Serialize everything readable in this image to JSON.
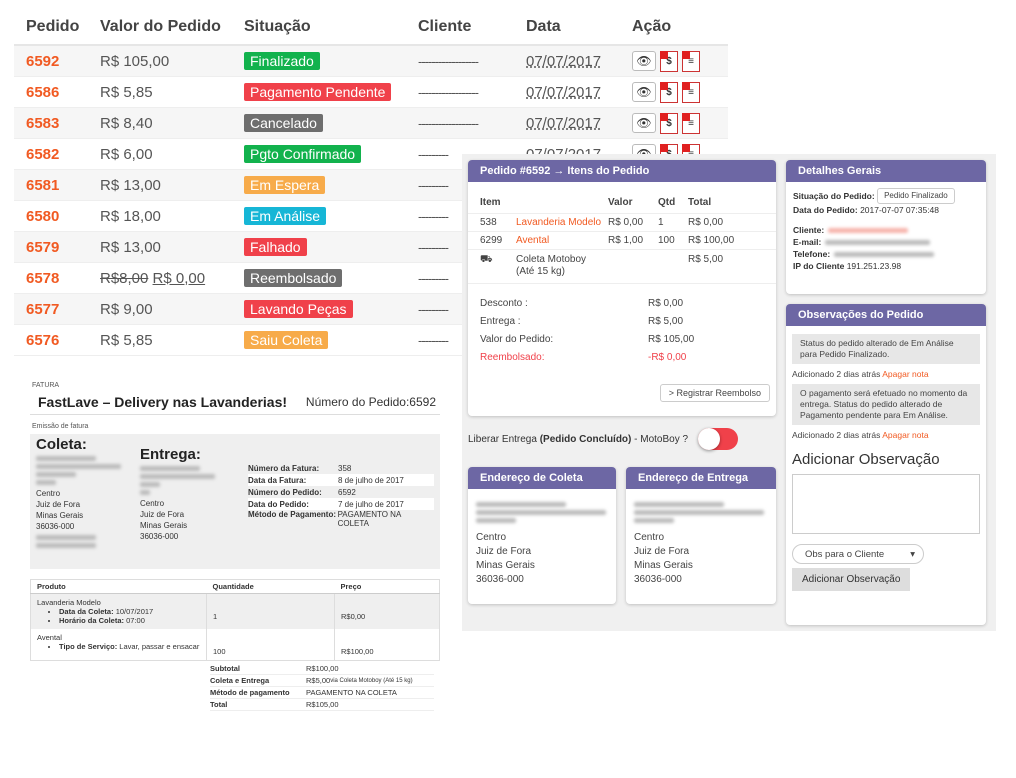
{
  "orders": {
    "headers": [
      "Pedido",
      "Valor do Pedido",
      "Situação",
      "Cliente",
      "Data",
      "Ação"
    ],
    "rows": [
      {
        "id": "6592",
        "value": "R$ 105,00",
        "status": "Finalizado",
        "color": "green",
        "client": "------------------",
        "date": "07/07/2017"
      },
      {
        "id": "6586",
        "value": "R$ 5,85",
        "status": "Pagamento Pendente",
        "color": "red",
        "client": "------------------",
        "date": "07/07/2017"
      },
      {
        "id": "6583",
        "value": "R$ 8,40",
        "status": "Cancelado",
        "color": "gray",
        "client": "------------------",
        "date": "07/07/2017"
      },
      {
        "id": "6582",
        "value": "R$ 6,00",
        "status": "Pgto Confirmado",
        "color": "green",
        "client": "---------",
        "date": "07/07/2017"
      },
      {
        "id": "6581",
        "value": "R$ 13,00",
        "status": "Em Espera",
        "color": "orange",
        "client": "---------",
        "date": ""
      },
      {
        "id": "6580",
        "value": "R$ 18,00",
        "status": "Em Análise",
        "color": "cyan",
        "client": "---------",
        "date": ""
      },
      {
        "id": "6579",
        "value": "R$ 13,00",
        "status": "Falhado",
        "color": "red",
        "client": "---------",
        "date": ""
      },
      {
        "id": "6578",
        "value_old": "R$8,00",
        "value": "R$ 0,00",
        "status": "Reembolsado",
        "color": "gray",
        "client": "---------",
        "date": ""
      },
      {
        "id": "6577",
        "value": "R$ 9,00",
        "status": "Lavando Peças",
        "color": "red",
        "client": "---------",
        "date": ""
      },
      {
        "id": "6576",
        "value": "R$ 5,85",
        "status": "Saiu Coleta",
        "color": "orange",
        "client": "---------",
        "date": ""
      }
    ],
    "status_colors": {
      "green": "#12b24d",
      "red": "#f0414a",
      "gray": "#6e6e6e",
      "orange": "#f7ab4a",
      "cyan": "#16b6d6"
    },
    "actions": [
      "eye-icon",
      "pdf-invoice-icon",
      "pdf-document-icon"
    ]
  },
  "invoice": {
    "label": "FATURA",
    "brand": "FastLave – Delivery nas Lavanderias!",
    "order_number": "Número do Pedido:6592",
    "emission": "Emissão de fatura",
    "coleta_title": "Coleta:",
    "entrega_title": "Entrega:",
    "coleta_addr": [
      "Centro",
      "Juiz de Fora",
      "Minas Gerais",
      "36036-000"
    ],
    "entrega_addr": [
      "Centro",
      "Juiz de Fora",
      "Minas Gerais",
      "36036-000"
    ],
    "meta": [
      {
        "k": "Número da Fatura:",
        "v": "358"
      },
      {
        "k": "Data da Fatura:",
        "v": "8 de julho de 2017"
      },
      {
        "k": "Número do Pedido:",
        "v": "6592"
      },
      {
        "k": "Data do Pedido:",
        "v": "7 de julho de 2017"
      },
      {
        "k": "Método de Pagamento:",
        "v": "PAGAMENTO NA COLETA"
      }
    ],
    "cols": [
      "Produto",
      "Quantidade",
      "Preço"
    ],
    "items": [
      {
        "name": "Lavanderia Modelo",
        "details": [
          {
            "k": "Data da Coleta:",
            "v": "10/07/2017"
          },
          {
            "k": "Horário da Coleta:",
            "v": "07:00"
          }
        ],
        "qty": "1",
        "price": "R$0,00"
      },
      {
        "name": "Avental",
        "details": [
          {
            "k": "Tipo de Serviço:",
            "v": "Lavar, passar e ensacar"
          }
        ],
        "qty": "100",
        "price": "R$100,00"
      }
    ],
    "totals": [
      {
        "k": "Subtotal",
        "v": "R$100,00",
        "note": ""
      },
      {
        "k": "Coleta e Entrega",
        "v": "R$5,00",
        "note": "via Coleta Motoboy (Até 15 kg)"
      },
      {
        "k": "Método de pagamento",
        "v": "PAGAMENTO NA COLETA",
        "note": ""
      },
      {
        "k": "Total",
        "v": "R$105,00",
        "note": ""
      }
    ]
  },
  "detail": {
    "items_title": "Pedido #6592 → Itens do Pedido",
    "cols": [
      "Item",
      "Valor",
      "Qtd",
      "Total"
    ],
    "items": [
      {
        "sku": "538",
        "name": "Lavanderia Modelo",
        "value": "R$ 0,00",
        "qty": "1",
        "total": "R$ 0,00"
      },
      {
        "sku": "6299",
        "name": "Avental",
        "value": "R$ 1,00",
        "qty": "100",
        "total": "R$ 100,00"
      }
    ],
    "shipping": {
      "name": "Coleta Motoboy",
      "sub": "(Até 15 kg)",
      "total": "R$ 5,00"
    },
    "summary": [
      {
        "k": "Desconto :",
        "v": "R$ 0,00"
      },
      {
        "k": "Entrega :",
        "v": "R$ 5,00"
      },
      {
        "k": "Valor do Pedido:",
        "v": "R$ 105,00"
      },
      {
        "k": "Reembolsado:",
        "v": "-R$ 0,00"
      }
    ],
    "refund_button": "> Registrar Reembolso",
    "toggle_prefix": "Liberar Entrega",
    "toggle_bold": "(Pedido Concluído)",
    "toggle_suffix": "- MotoBoy ?",
    "coleta_title": "Endereço de Coleta",
    "entrega_title": "Endereço de Entrega",
    "address_lines": [
      "Centro",
      "Juiz de Fora",
      "Minas Gerais",
      "36036-000"
    ],
    "general_title": "Detalhes Gerais",
    "status_label": "Situação do Pedido:",
    "status_value": "Pedido Finalizado",
    "date_label": "Data do Pedido:",
    "date_value": "2017-07-07 07:35:48",
    "client_label": "Cliente:",
    "email_label": "E-mail:",
    "phone_label": "Telefone:",
    "ip_label": "IP do Cliente",
    "ip_value": "191.251.23.98",
    "obs_title": "Observações do Pedido",
    "notes": [
      {
        "text": "Status do pedido alterado de Em Análise para Pedido Finalizado.",
        "meta": "Adicionado 2 dias atrás",
        "delete": "Apagar nota"
      },
      {
        "text": "O pagamento será efetuado no momento da entrega. Status do pedido alterado de Pagamento pendente para Em Análise.",
        "meta": "Adicionado 2 dias atrás",
        "delete": "Apagar nota"
      }
    ],
    "add_title": "Adicionar Observação",
    "select_value": "Obs para o Cliente",
    "add_button": "Adicionar Observação"
  }
}
